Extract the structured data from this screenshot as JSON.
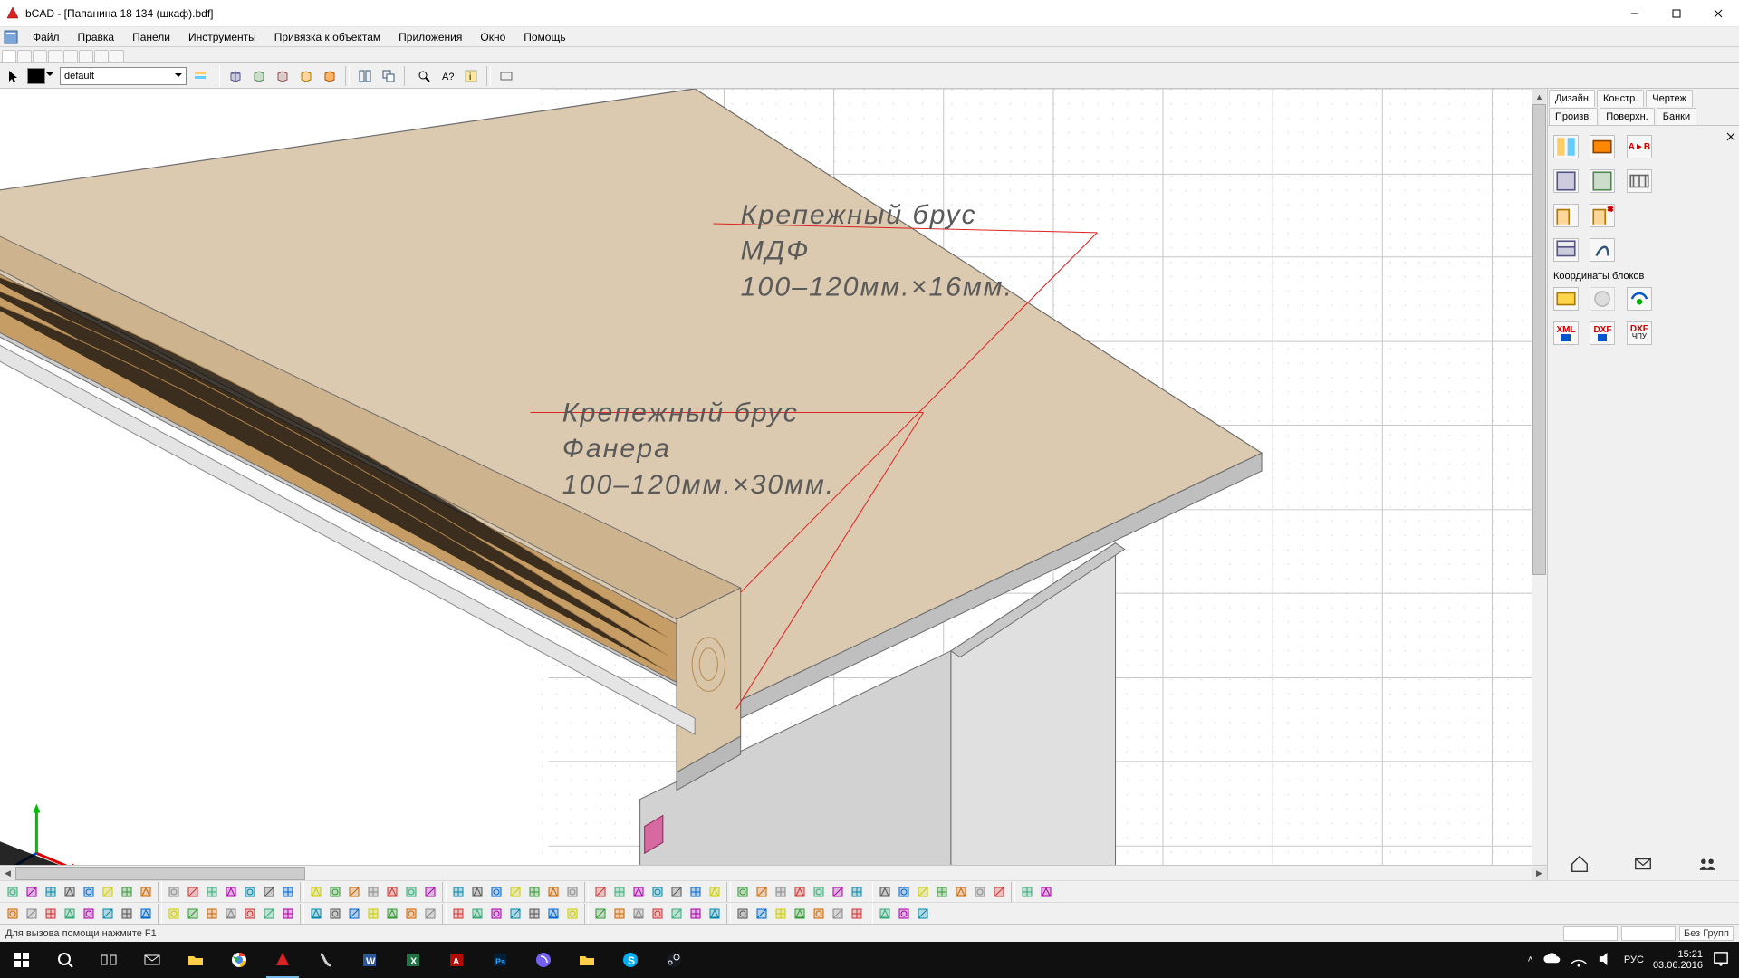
{
  "title": "bCAD - [Папанина 18 134 (шкаф).bdf]",
  "menu": [
    "Файл",
    "Правка",
    "Панели",
    "Инструменты",
    "Привязка к объектам",
    "Приложения",
    "Окно",
    "Помощь"
  ],
  "layer_combo": "default",
  "right_panel": {
    "tabs_row1": [
      "Дизайн",
      "Констр.",
      "Чертеж",
      "Произв."
    ],
    "tabs_row2": [
      "Поверхн.",
      "Банки"
    ],
    "section_label": "Координаты блоков",
    "btn_ab": "A►B",
    "btn_xml": "XML",
    "btn_dxf1": "DXF",
    "btn_dxf2": "DXF",
    "btn_dxf2_sub": "ЧПУ"
  },
  "status_text": "Для вызова помощи нажмите F1",
  "status_group": "Без Групп",
  "annotations": {
    "a1_l1": "Крепежный  брус",
    "a1_l2": "МДФ",
    "a1_l3": "100–120мм.×16мм.",
    "a2_l1": "Крепежный  брус",
    "a2_l2": "Фанера",
    "a2_l3": "100–120мм.×30мм."
  },
  "tray": {
    "lang": "РУС",
    "time": "15:21",
    "date": "03.06.2016"
  },
  "colors": {
    "panel_top": "#dcc9ae",
    "panel_side": "#d8d8d8",
    "wood": "#c89b63",
    "wood_dark": "#a87a42",
    "edge": "#6b6b6b",
    "leader": "#d22"
  }
}
